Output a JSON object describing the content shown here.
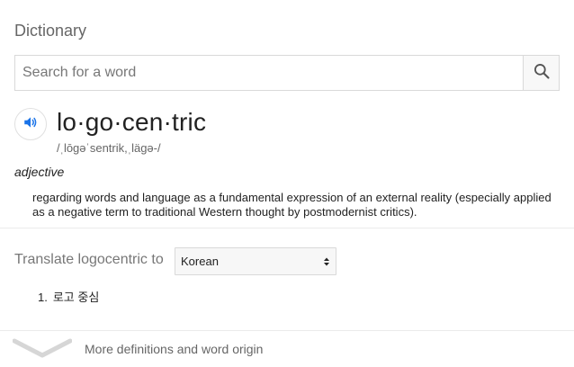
{
  "card": {
    "title": "Dictionary"
  },
  "search": {
    "placeholder": "Search for a word",
    "value": ""
  },
  "entry": {
    "word": "lo·go·cen·tric",
    "phonetic": "/ˌlōɡəˈsentrik,ˌläɡə-/",
    "part_of_speech": "adjective",
    "definition": "regarding words and language as a fundamental expression of an external reality (especially applied as a negative term to traditional Western thought by postmodernist critics)."
  },
  "translate": {
    "label": "Translate logocentric to",
    "selected_language": "Korean",
    "results": [
      {
        "number": "1.",
        "text": "로고 중심"
      }
    ]
  },
  "footer": {
    "more_label": "More definitions and word origin"
  },
  "colors": {
    "accent_blue": "#1a73e8",
    "muted_text": "#666666",
    "border": "#d9d9d9"
  },
  "icons": {
    "search": "search-icon",
    "speaker": "speaker-icon",
    "expand": "chevron-down-icon",
    "select": "select-arrows-icon"
  }
}
